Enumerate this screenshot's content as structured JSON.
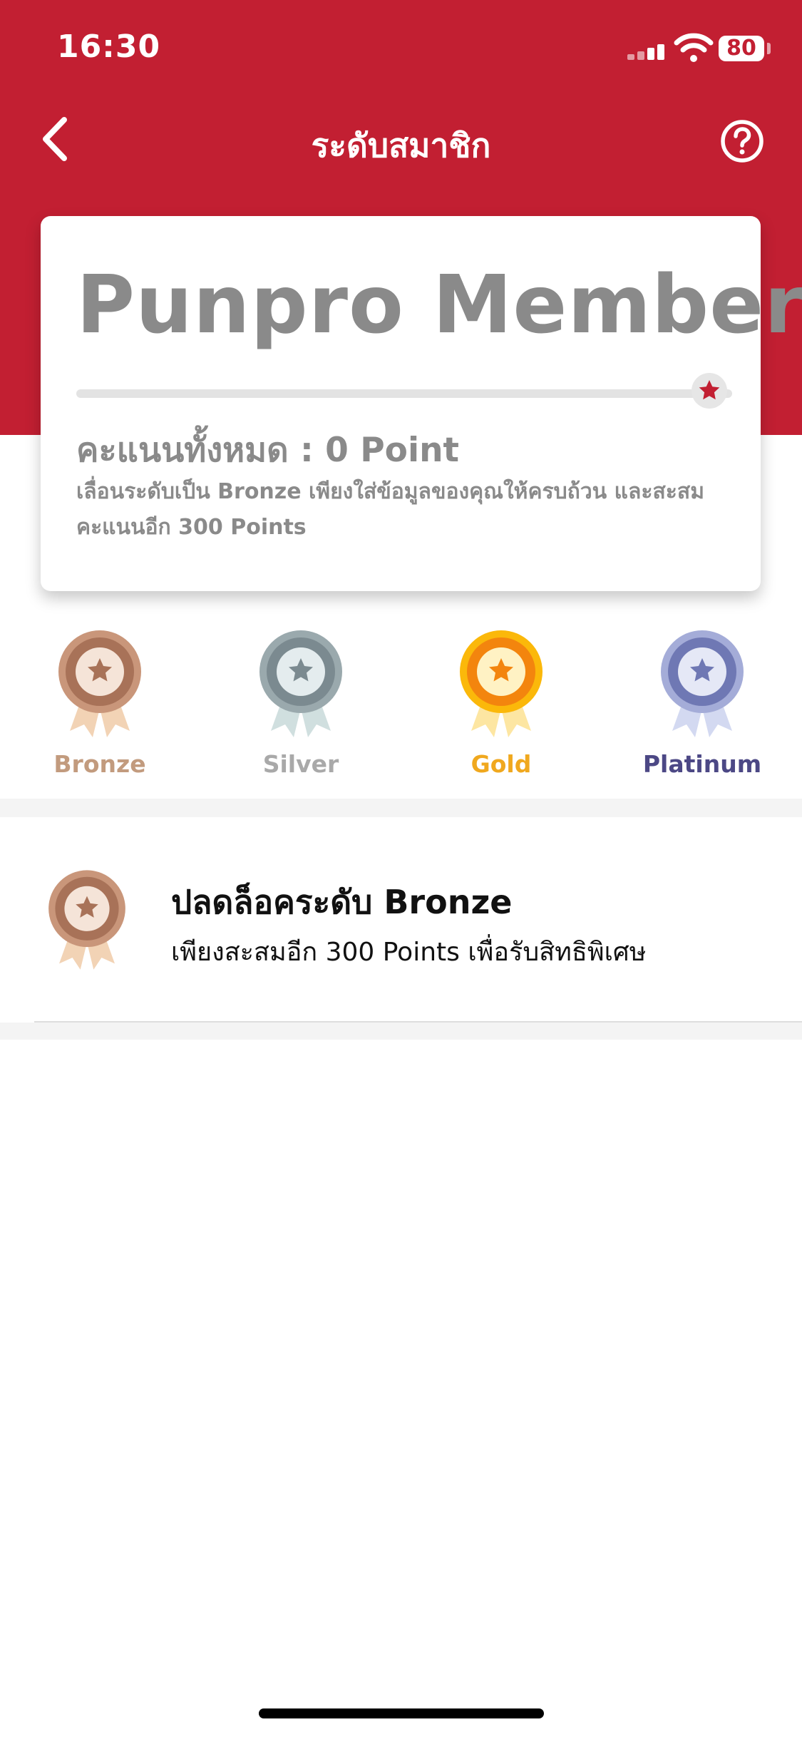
{
  "status": {
    "time": "16:30",
    "battery": "80"
  },
  "nav": {
    "back_icon": "chevron-left-icon",
    "title": "ระดับสมาชิก",
    "help_icon": "question-circle-icon"
  },
  "card": {
    "title": "Punpro Member",
    "progress": 0,
    "points_text": "คะแนนทั้งหมด : 0 Point",
    "description": "เลื่อนระดับเป็น Bronze เพียงใส่ข้อมูลของคุณให้ครบถ้วน และสะสมคะแนนอีก 300 Points"
  },
  "tiers": [
    {
      "label": "Bronze",
      "color": "#c29b7e",
      "icon": "bronze-medal-icon"
    },
    {
      "label": "Silver",
      "color": "#a9a9a9",
      "icon": "silver-medal-icon"
    },
    {
      "label": "Gold",
      "color": "#f0a81e",
      "icon": "gold-medal-icon"
    },
    {
      "label": "Platinum",
      "color": "#4c4885",
      "icon": "platinum-medal-icon"
    }
  ],
  "unlock": {
    "title": "ปลดล็อคระดับ Bronze",
    "subtitle": "เพียงสะสมอีก 300 Points เพื่อรับสิทธิพิเศษ"
  },
  "colors": {
    "brand_red": "#c21f32"
  }
}
